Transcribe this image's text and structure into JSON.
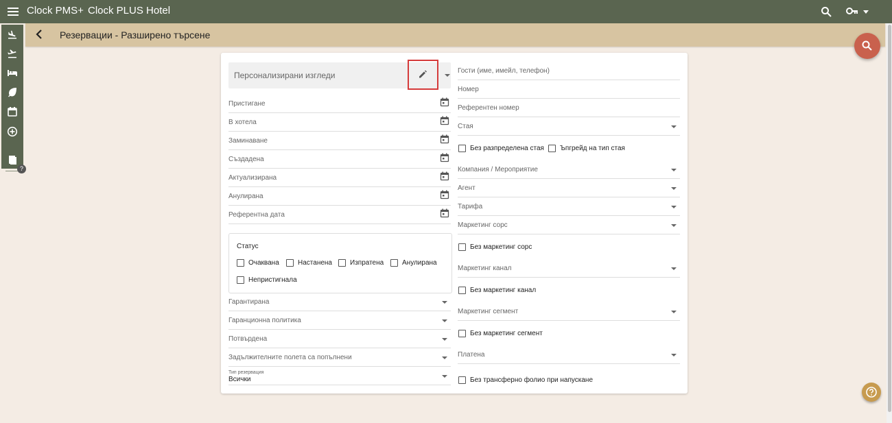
{
  "topbar": {
    "app_name": "Clock PMS+",
    "hotel_name": "Clock PLUS Hotel"
  },
  "page": {
    "title": "Резервации - Разширено търсене"
  },
  "sidebar": {
    "icons": [
      "arrivals-icon",
      "departures-icon",
      "bed-icon",
      "leaf-icon",
      "calendar-icon",
      "add-circle-icon",
      "book-icon"
    ],
    "help": "?"
  },
  "views": {
    "placeholder": "Персонализирани изгледи"
  },
  "left_fields": {
    "dates": [
      "Пристигане",
      "В хотела",
      "Заминаване",
      "Създадена",
      "Актуализирана",
      "Анулирана",
      "Референтна дата"
    ],
    "status_title": "Статус",
    "status_options": [
      "Очаквана",
      "Настанена",
      "Изпратена",
      "Анулирана",
      "Непристигнала"
    ],
    "dropdowns": [
      "Гарантирана",
      "Гаранционна политика",
      "Потвърдена",
      "Задължителните полета са попълнени"
    ],
    "reservation_type": {
      "label": "Тип резервация",
      "value": "Всички"
    }
  },
  "right_fields": {
    "guests": "Гости (име, имейл, телефон)",
    "number": "Номер",
    "reference": "Референтен номер",
    "room": "Стая",
    "no_room": "Без разпределена стая",
    "upgrade": "Ъпгрейд на тип стая",
    "company": "Компания / Мероприятие",
    "agent": "Агент",
    "rate": "Тарифа",
    "marketing_source": "Маркетинг сорс",
    "no_marketing_source": "Без маркетинг сорс",
    "marketing_channel": "Маркетинг канал",
    "no_marketing_channel": "Без маркетинг канал",
    "marketing_segment": "Маркетинг сегмент",
    "no_marketing_segment": "Без маркетинг сегмент",
    "paid": "Платена",
    "no_transfer_folio": "Без трансферно фолио при напускане"
  },
  "fab_help": "?"
}
